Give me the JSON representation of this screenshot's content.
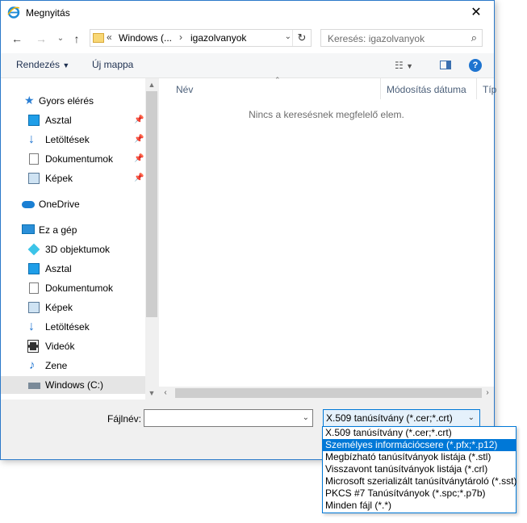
{
  "window": {
    "title": "Megnyitás",
    "close_glyph": "✕"
  },
  "nav": {
    "back": "←",
    "forward": "→",
    "up": "↑",
    "address_crumbs": [
      "Windows (...",
      "igazolvanyok"
    ],
    "address_prefix": "«",
    "search_placeholder": "Keresés: igazolvanyok"
  },
  "toolbar": {
    "organize": "Rendezés",
    "new_folder": "Új mappa",
    "help": "?"
  },
  "sidebar": {
    "items": [
      {
        "label": "Gyors elérés",
        "icon": "star-icon",
        "pinned": false
      },
      {
        "label": "Asztal",
        "icon": "desktop-icon",
        "pinned": true
      },
      {
        "label": "Letöltések",
        "icon": "download-icon",
        "pinned": true
      },
      {
        "label": "Dokumentumok",
        "icon": "document-icon",
        "pinned": true
      },
      {
        "label": "Képek",
        "icon": "pictures-icon",
        "pinned": true
      },
      {
        "label": "OneDrive",
        "icon": "cloud-icon",
        "pinned": false
      },
      {
        "label": "Ez a gép",
        "icon": "computer-icon",
        "pinned": false
      },
      {
        "label": "3D objektumok",
        "icon": "cube-icon",
        "pinned": false
      },
      {
        "label": "Asztal",
        "icon": "desktop-icon",
        "pinned": false
      },
      {
        "label": "Dokumentumok",
        "icon": "document-icon",
        "pinned": false
      },
      {
        "label": "Képek",
        "icon": "pictures-icon",
        "pinned": false
      },
      {
        "label": "Letöltések",
        "icon": "download-icon",
        "pinned": false
      },
      {
        "label": "Videók",
        "icon": "video-icon",
        "pinned": false
      },
      {
        "label": "Zene",
        "icon": "music-icon",
        "pinned": false
      },
      {
        "label": "Windows (C:)",
        "icon": "drive-icon",
        "pinned": false
      }
    ]
  },
  "columns": {
    "name": "Név",
    "modified": "Módosítás dátuma",
    "type": "Típ"
  },
  "empty_message": "Nincs a keresésnek megfelelő elem.",
  "bottom": {
    "filename_label": "Fájlnév:",
    "filename_value": "",
    "filetype_selected": "X.509 tanúsítvány (*.cer;*.crt)"
  },
  "filetype_options": [
    "X.509 tanúsítvány (*.cer;*.crt)",
    "Személyes információcsere (*.pfx;*.p12)",
    "Megbízható tanúsítványok listája (*.stl)",
    "Visszavont tanúsítványok listája (*.crl)",
    "Microsoft szerializált tanúsítványtároló (*.sst)",
    "PKCS #7 Tanúsítványok (*.spc;*.p7b)",
    "Minden fájl (*.*)"
  ],
  "colors": {
    "accent": "#0078d7",
    "selection": "#cce8ff",
    "window_border": "#2b79c9"
  }
}
